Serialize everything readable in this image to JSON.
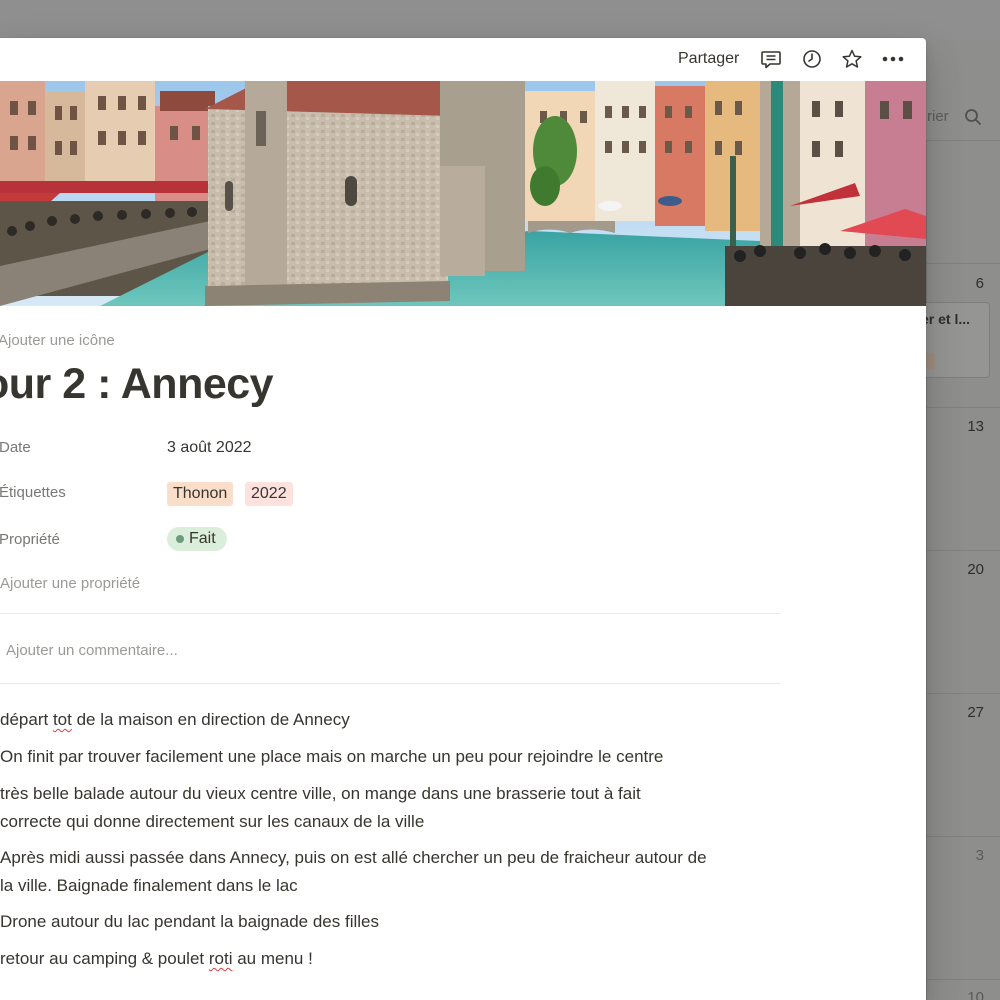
{
  "background": {
    "toolbar_text": "rier",
    "day_numbers": [
      "6",
      "13",
      "20",
      "27",
      "3",
      "10"
    ],
    "card_title": "er et l..."
  },
  "topbar": {
    "share_label": "Partager"
  },
  "page": {
    "add_icon_label": "Ajouter une icône",
    "title": "our 2 : Annecy",
    "properties": {
      "date": {
        "label": "Date",
        "value": "3 août 2022"
      },
      "tags": {
        "label": "Étiquettes",
        "items": [
          "Thonon",
          "2022"
        ]
      },
      "status": {
        "label": "Propriété",
        "value": "Fait"
      }
    },
    "add_property_label": "Ajouter une propriété",
    "comment_placeholder": "Ajouter un commentaire...",
    "paragraphs": [
      {
        "line1_a": "départ ",
        "line1_spell": "tot",
        "line1_b": " de la maison en direction de Annecy"
      },
      {
        "line1": "On finit par trouver facilement une place mais on marche un peu pour rejoindre le centre"
      },
      {
        "line1": "très belle balade autour du vieux centre ville, on mange dans une brasserie tout à fait",
        "line2": "correcte qui donne directement sur les canaux de la ville"
      },
      {
        "line1": "Après midi aussi passée dans Annecy, puis on est allé chercher un peu de fraicheur autour de",
        "line2": "la ville. Baignade finalement dans le lac"
      },
      {
        "line1": "Drone autour du lac pendant la baignade des filles"
      },
      {
        "line1_a": "retour au camping & poulet ",
        "line1_spell": "roti",
        "line1_b": " au menu !"
      }
    ]
  },
  "colors": {
    "tag_thonon": "#fadec9",
    "tag_2022": "#ffe2dd",
    "status_bg": "#dbeddb",
    "status_dot": "#6c9b7d"
  },
  "icons": [
    "comment-icon",
    "clock-icon",
    "star-icon",
    "more-icon",
    "search-icon"
  ]
}
